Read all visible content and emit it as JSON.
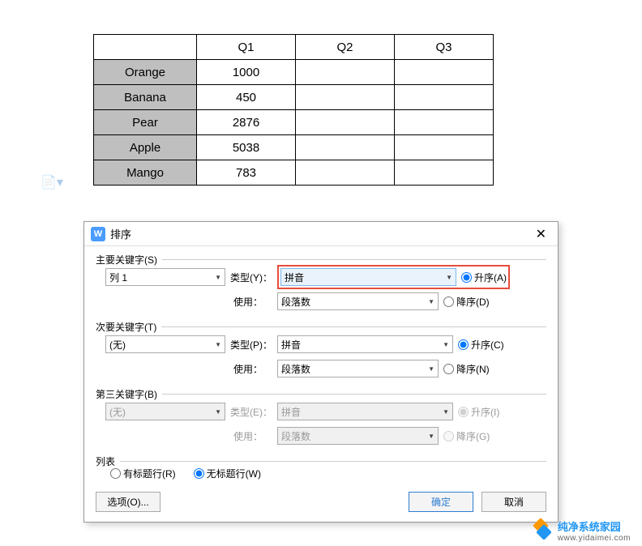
{
  "table": {
    "headers": [
      "",
      "Q1",
      "Q2",
      "Q3"
    ],
    "rows": [
      {
        "name": "Orange",
        "q1": "1000",
        "q2": "",
        "q3": ""
      },
      {
        "name": "Banana",
        "q1": "450",
        "q2": "",
        "q3": ""
      },
      {
        "name": "Pear",
        "q1": "2876",
        "q2": "",
        "q3": ""
      },
      {
        "name": "Apple",
        "q1": "5038",
        "q2": "",
        "q3": ""
      },
      {
        "name": "Mango",
        "q1": "783",
        "q2": "",
        "q3": ""
      }
    ]
  },
  "dialog": {
    "title": "排序",
    "primary": {
      "legend": "主要关键字(S)",
      "field": "列 1",
      "type_label": "类型(Y)：",
      "type_value": "拼音",
      "use_label": "使用：",
      "use_value": "段落数",
      "asc": "升序(A)",
      "desc": "降序(D)"
    },
    "secondary": {
      "legend": "次要关键字(T)",
      "field": "(无)",
      "type_label": "类型(P)：",
      "type_value": "拼音",
      "use_label": "使用：",
      "use_value": "段落数",
      "asc": "升序(C)",
      "desc": "降序(N)"
    },
    "tertiary": {
      "legend": "第三关键字(B)",
      "field": "(无)",
      "type_label": "类型(E)：",
      "type_value": "拼音",
      "use_label": "使用：",
      "use_value": "段落数",
      "asc": "升序(I)",
      "desc": "降序(G)"
    },
    "list": {
      "legend": "列表",
      "has_header": "有标题行(R)",
      "no_header": "无标题行(W)"
    },
    "buttons": {
      "options": "选项(O)...",
      "ok": "确定",
      "cancel": "取消"
    }
  },
  "watermark": {
    "name": "纯净系统家园",
    "url": "www.yidaimei.com"
  }
}
